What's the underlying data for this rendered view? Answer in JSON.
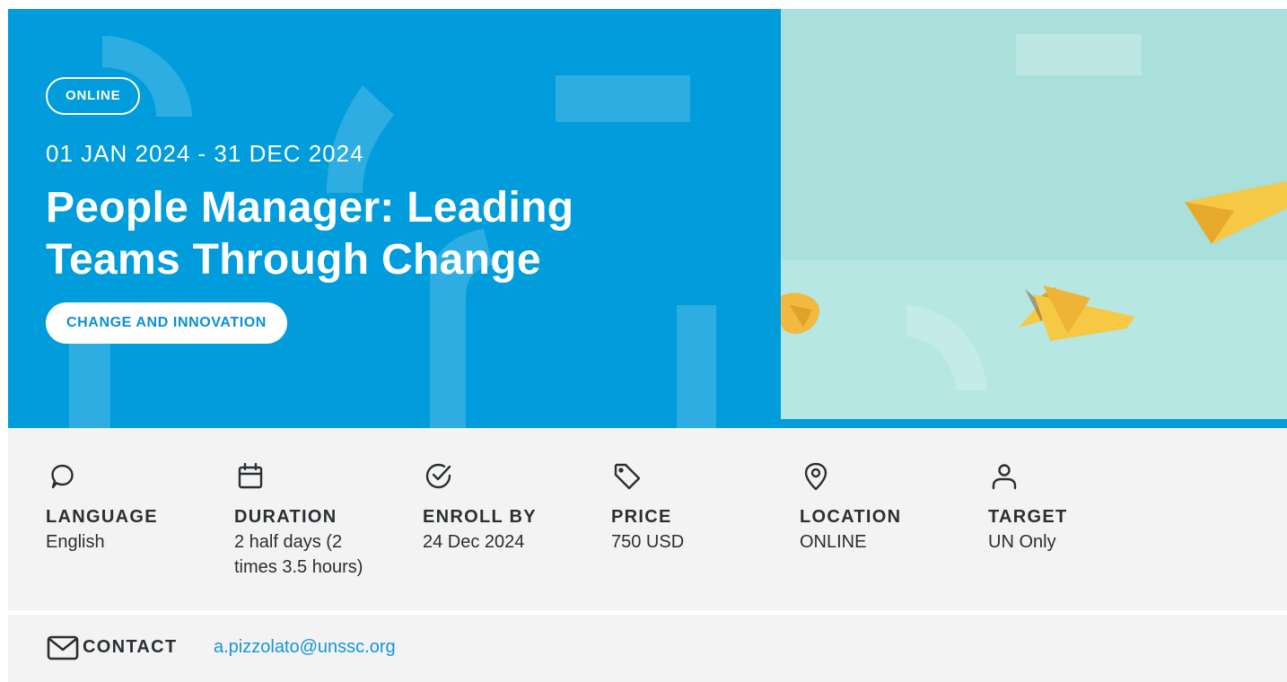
{
  "hero": {
    "delivery_badge": "ONLINE",
    "dates": "01 JAN 2024 - 31 DEC 2024",
    "title_line1": "People Manager: Leading",
    "title_line2": "Teams Through Change",
    "topic_badge": "CHANGE AND INNOVATION",
    "background_color": "#009cdc",
    "photo_bg_color": "#a9e0dc",
    "photo_accent_color": "#f6c843"
  },
  "info": {
    "items": [
      {
        "icon": "speech-bubble-icon",
        "label": "LANGUAGE",
        "value": "English"
      },
      {
        "icon": "calendar-icon",
        "label": "DURATION",
        "value_line1": "2 half days (2",
        "value_line2": "times 3.5 hours)"
      },
      {
        "icon": "check-circle-icon",
        "label": "ENROLL BY",
        "value": "24 Dec 2024"
      },
      {
        "icon": "price-tag-icon",
        "label": "PRICE",
        "value": "750 USD"
      },
      {
        "icon": "location-pin-icon",
        "label": "LOCATION",
        "value": "ONLINE"
      },
      {
        "icon": "user-icon",
        "label": "TARGET",
        "value": "UN Only"
      }
    ]
  },
  "contact": {
    "icon": "envelope-icon",
    "label": "CONTACT",
    "email": "a.pizzolato@unssc.org",
    "link_color": "#1696d8"
  }
}
